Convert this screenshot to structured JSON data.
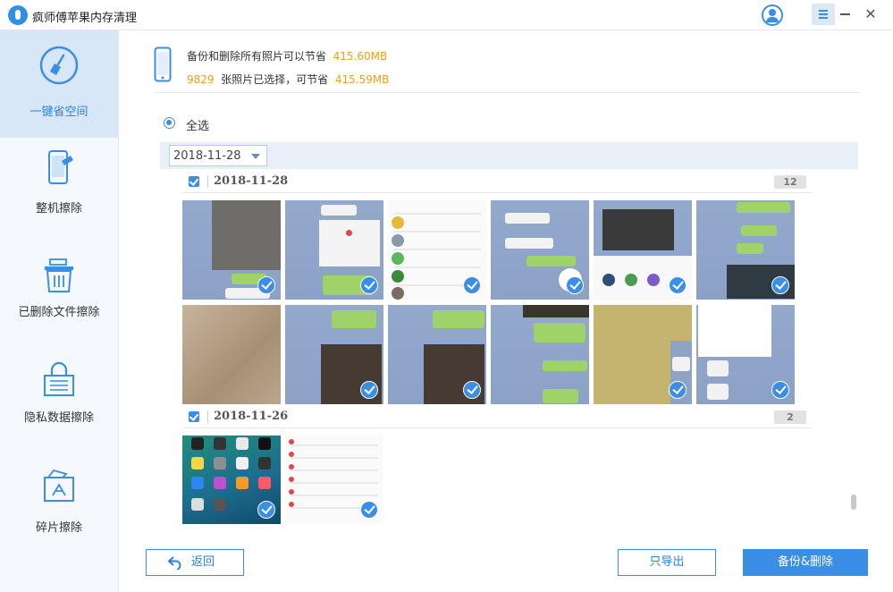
{
  "app": {
    "title": "疯师傅苹果内存清理"
  },
  "titlebar": {
    "close_glyph": "✕"
  },
  "sidebar": {
    "items": [
      {
        "label": "一键省空间",
        "icon": "broom-icon",
        "active": true
      },
      {
        "label": "整机擦除",
        "icon": "phone-erase-icon",
        "active": false
      },
      {
        "label": "已删除文件擦除",
        "icon": "trash-icon",
        "active": false
      },
      {
        "label": "隐私数据擦除",
        "icon": "lock-icon",
        "active": false
      },
      {
        "label": "碎片擦除",
        "icon": "fragment-icon",
        "active": false
      }
    ]
  },
  "info": {
    "line1_text": "备份和删除所有照片可以节省",
    "line1_size": "415.60MB",
    "line2_count": "9829",
    "line2_text": "张照片已选择，可节省",
    "line2_size": "415.59MB"
  },
  "select_all": {
    "label": "全选"
  },
  "filter": {
    "date_value": "2018-11-28"
  },
  "groups": [
    {
      "date": "2018-11-28",
      "count": "12"
    },
    {
      "date": "2018-11-26",
      "count": "2"
    }
  ],
  "buttons": {
    "back": "返回",
    "export": "只导出",
    "backup_delete": "备份&删除"
  }
}
